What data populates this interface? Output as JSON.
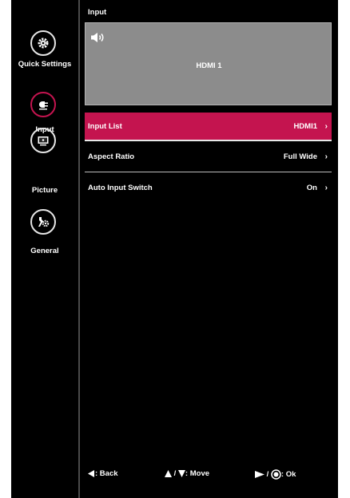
{
  "sidebar": {
    "items": [
      {
        "label": "Quick Settings",
        "icon": "gear-icon",
        "active": false
      },
      {
        "label": "Input",
        "icon": "input-plug-icon",
        "active": true
      },
      {
        "label": "Picture",
        "icon": "picture-monitor-icon",
        "active": false
      },
      {
        "label": "General",
        "icon": "general-wrench-icon",
        "active": false
      }
    ]
  },
  "header": {
    "title": "Input"
  },
  "preview": {
    "source": "HDMI 1",
    "icon": "volume-icon"
  },
  "menu": {
    "rows": [
      {
        "label": "Input List",
        "value": "HDMI1",
        "selected": true
      },
      {
        "label": "Aspect Ratio",
        "value": "Full Wide",
        "selected": false
      },
      {
        "label": "Auto Input Switch",
        "value": "On",
        "selected": false
      }
    ],
    "chevron": "›"
  },
  "hints": {
    "back": ": Back",
    "move_sep": "/",
    "move": ": Move",
    "ok_sep": "/",
    "ok": ": Ok"
  },
  "colors": {
    "highlight": "#c4144f",
    "preview_bg": "#8c8c8c",
    "background": "#000000"
  }
}
